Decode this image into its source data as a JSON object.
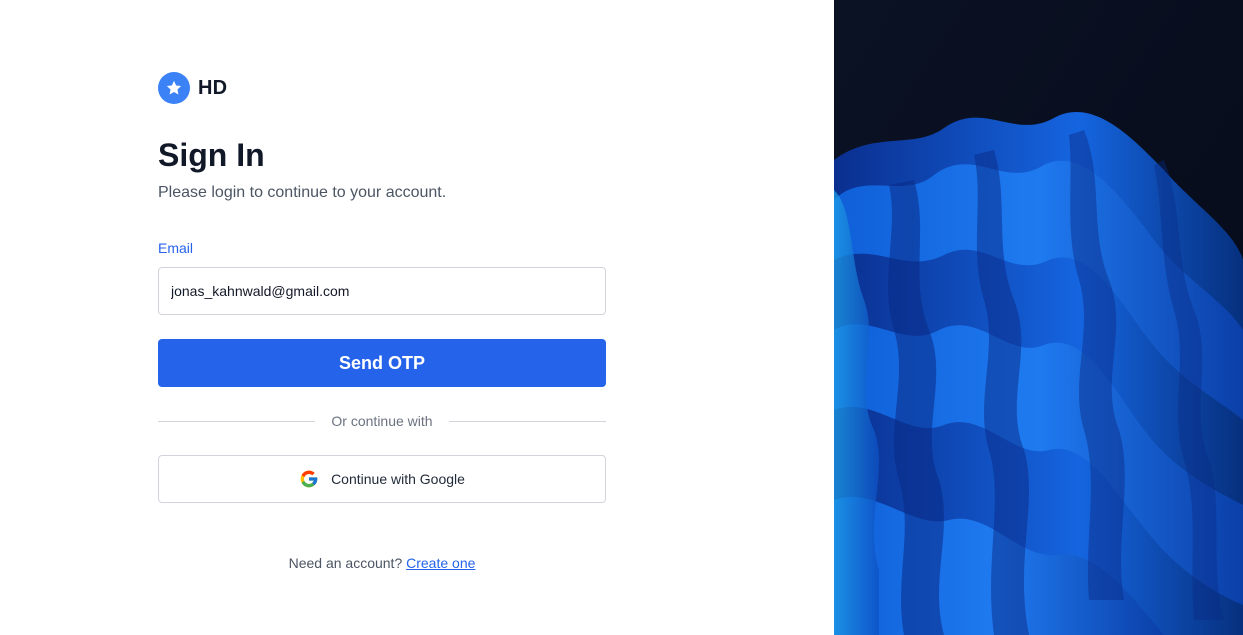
{
  "brand": {
    "logo_icon": "star-icon",
    "name": "HD",
    "accent": "#3b82f6"
  },
  "signin": {
    "title": "Sign In",
    "subtitle": "Please login to continue to your account."
  },
  "email": {
    "label": "Email",
    "value": "jonas_kahnwald@gmail.com"
  },
  "send_otp": {
    "label": "Send OTP",
    "color": "#2563eb"
  },
  "divider": {
    "text": "Or continue with"
  },
  "google": {
    "icon": "google-icon",
    "label": "Continue with Google"
  },
  "footer": {
    "prompt": "Need an account?",
    "link": "Create one"
  },
  "hero": {
    "description_icon": "abstract-blue-waves-image"
  }
}
